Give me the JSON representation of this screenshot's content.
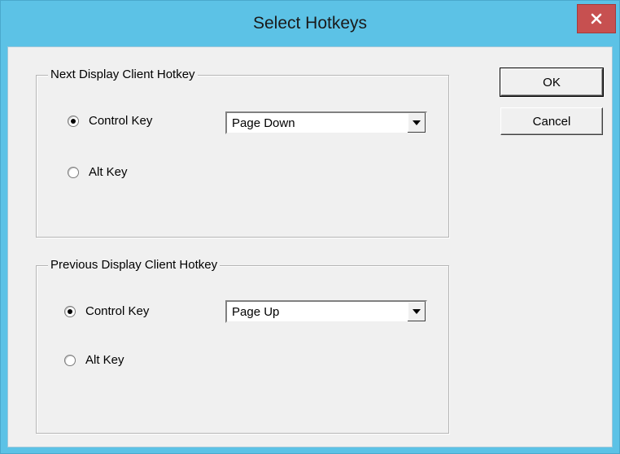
{
  "window": {
    "title": "Select Hotkeys",
    "close_icon": "close-icon"
  },
  "next_group": {
    "label": "Next Display Client Hotkey",
    "options": [
      {
        "label": "Control Key",
        "checked": true
      },
      {
        "label": "Alt Key",
        "checked": false
      }
    ],
    "key_select": {
      "value": "Page Down"
    }
  },
  "previous_group": {
    "label": "Previous Display Client Hotkey",
    "options": [
      {
        "label": "Control Key",
        "checked": true
      },
      {
        "label": "Alt Key",
        "checked": false
      }
    ],
    "key_select": {
      "value": "Page Up"
    }
  },
  "buttons": {
    "ok": "OK",
    "cancel": "Cancel"
  },
  "colors": {
    "title_bar": "#5cc2e6",
    "close_button": "#c75050",
    "dialog_face": "#f0f0f0"
  }
}
